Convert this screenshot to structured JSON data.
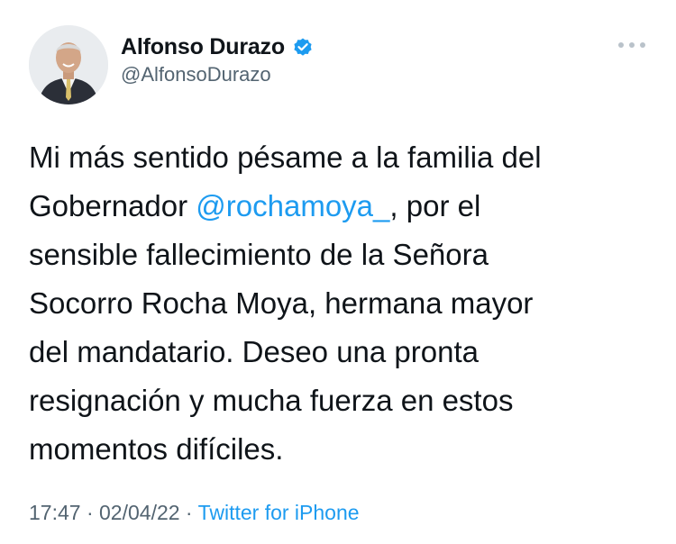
{
  "author": {
    "name": "Alfonso Durazo",
    "handle": "@AlfonsoDurazo",
    "verified_icon": "verified-badge-icon",
    "avatar_icon": "profile-photo"
  },
  "more_icon": "more-options-icon",
  "tweet": {
    "lines": [
      {
        "before": "Mi más sentido pésame a la familia del",
        "mention": "",
        "after": ""
      },
      {
        "before": "Gobernador ",
        "mention": "@rochamoya_",
        "after": ", por el"
      },
      {
        "before": "sensible fallecimiento de la Señora",
        "mention": "",
        "after": ""
      },
      {
        "before": "Socorro Rocha Moya, hermana mayor",
        "mention": "",
        "after": ""
      },
      {
        "before": "del mandatario. Deseo una pronta",
        "mention": "",
        "after": ""
      },
      {
        "before": "resignación y mucha fuerza en estos",
        "mention": "",
        "after": ""
      },
      {
        "before": "momentos difíciles.",
        "mention": "",
        "after": ""
      }
    ]
  },
  "meta": {
    "time": "17:47",
    "separator": " · ",
    "date": "02/04/22",
    "source": "Twitter for iPhone"
  },
  "colors": {
    "link": "#1d9bf0",
    "text": "#0f1419",
    "secondary": "#536471"
  }
}
